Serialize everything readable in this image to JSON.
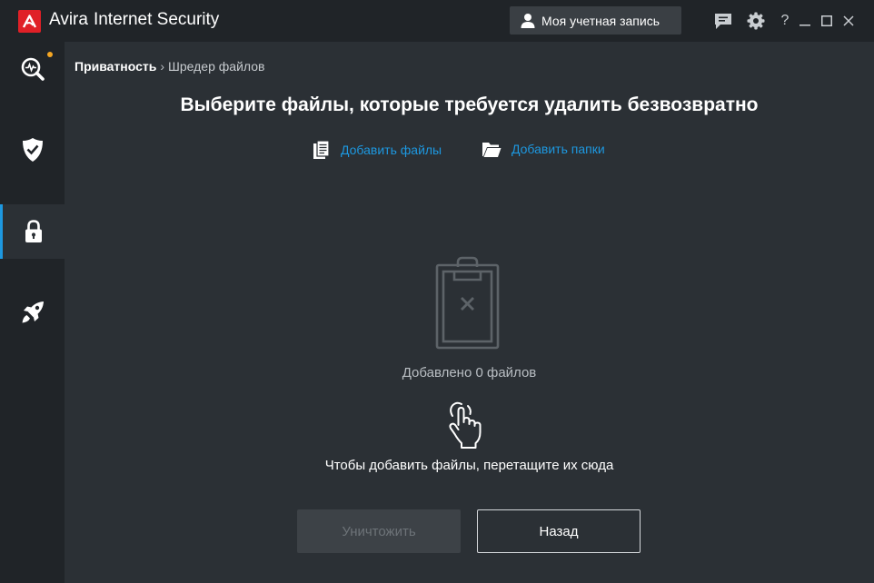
{
  "app": {
    "brand": "Avira",
    "product": "Internet Security"
  },
  "header": {
    "account_label": "Моя учетная запись",
    "help_glyph": "?"
  },
  "colors": {
    "accent": "#1d98e0",
    "brand_red": "#e02027",
    "notify": "#f5a623"
  },
  "sidebar": {
    "items": [
      {
        "name": "status",
        "icon": "scan-pulse-icon",
        "active": false
      },
      {
        "name": "security",
        "icon": "shield-check-icon",
        "active": false
      },
      {
        "name": "privacy",
        "icon": "lock-icon",
        "active": true
      },
      {
        "name": "performance",
        "icon": "rocket-icon",
        "active": false
      }
    ]
  },
  "breadcrumb": {
    "root": "Приватность",
    "separator": "›",
    "current": "Шредер файлов"
  },
  "main": {
    "title": "Выберите файлы, которые требуется удалить безвозвратно",
    "add_files": "Добавить файлы",
    "add_folders": "Добавить папки",
    "files_added": "Добавлено 0 файлов",
    "drop_hint": "Чтобы добавить файлы, перетащите их сюда",
    "destroy_label": "Уничтожить",
    "back_label": "Назад"
  }
}
